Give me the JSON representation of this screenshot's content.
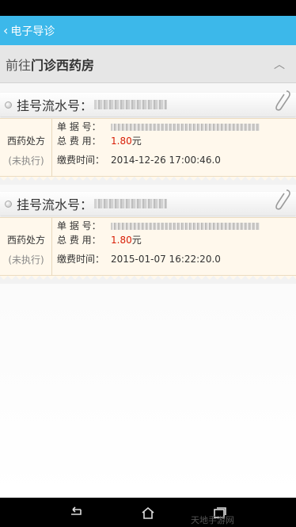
{
  "app_bar": {
    "back_glyph": "‹",
    "title": "电子导诊"
  },
  "section": {
    "prefix": "前往",
    "place": "门诊西药房",
    "chevron": "︿"
  },
  "serial_label": "挂号流水号：",
  "labels": {
    "receipt_no": "单 据 号：",
    "total_fee": "总 费 用：",
    "pay_time": "缴费时间："
  },
  "records": [
    {
      "type": "西药处方",
      "status": "(未执行)",
      "total_fee": "1.80",
      "currency_unit": "元",
      "pay_time": "2014-12-26 17:00:46.0"
    },
    {
      "type": "西药处方",
      "status": "(未执行)",
      "total_fee": "1.80",
      "currency_unit": "元",
      "pay_time": "2015-01-07 16:22:20.0"
    }
  ],
  "watermark": "天地手游网",
  "colors": {
    "app_bar": "#3cb8ea",
    "price": "#d81e06"
  },
  "icons": [
    "back-icon",
    "paperclip-icon",
    "nav-back-icon",
    "nav-home-icon",
    "nav-recents-icon"
  ]
}
